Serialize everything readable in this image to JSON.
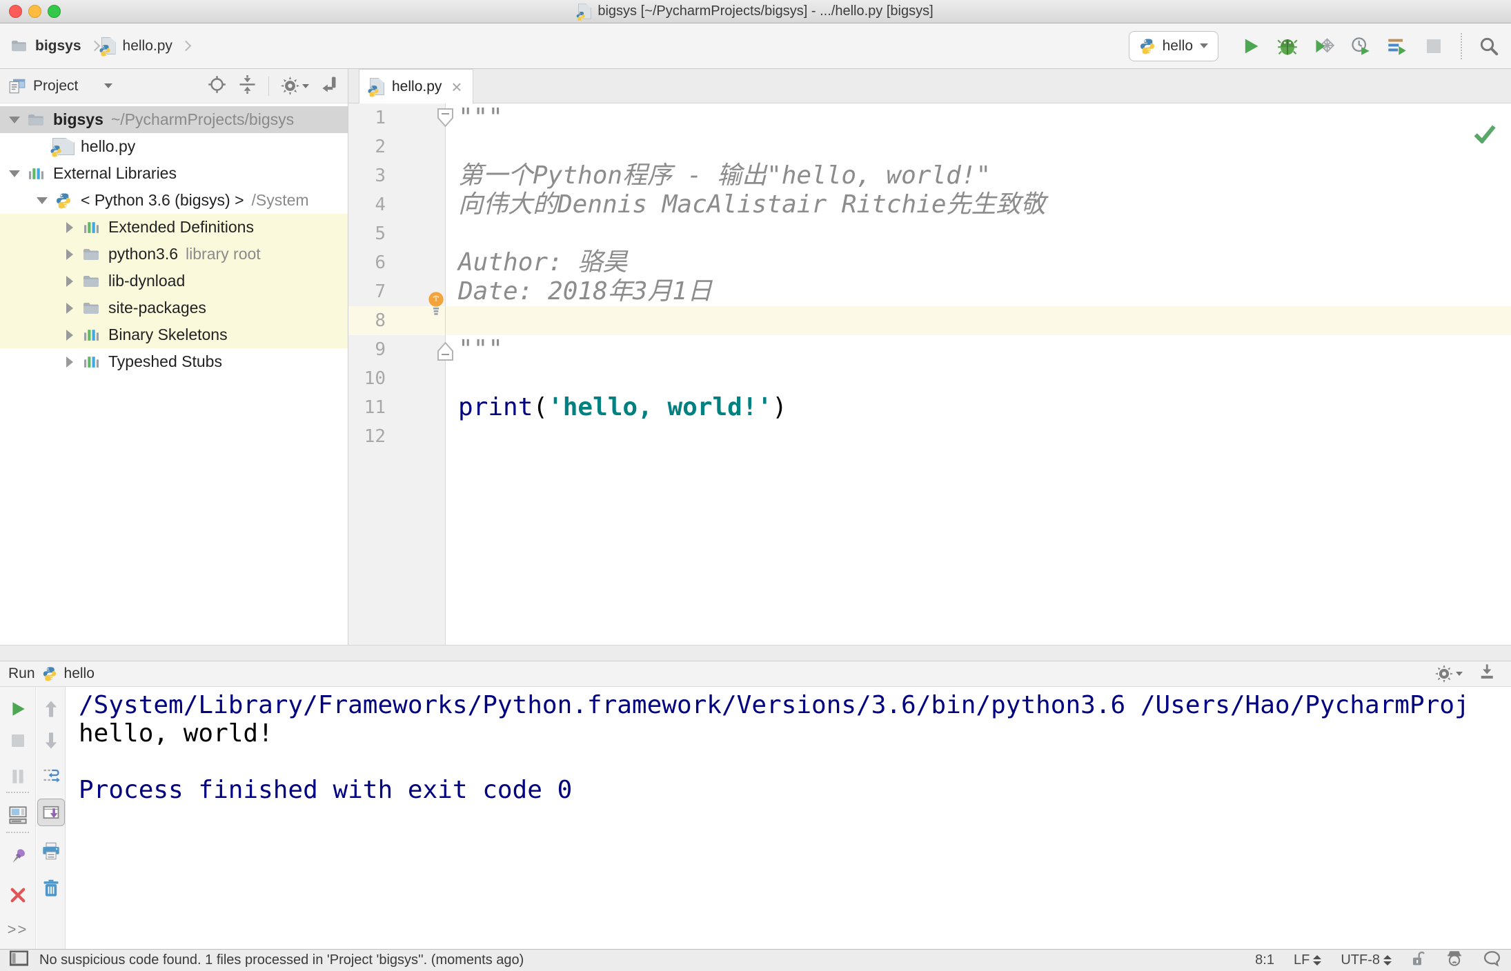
{
  "colors": {
    "run_green": "#4DA651",
    "keyword_blue": "#000080",
    "string_teal": "#008080",
    "console_blue": "#000080",
    "doc_comment_gray": "#8C8C8C",
    "selection_gray": "#D5D5D5",
    "scope_highlight_yellow": "#FBF9DC",
    "current_line_yellow": "#FCF9E7",
    "error_red": "#E05555",
    "pin_purple": "#A87BC9"
  },
  "title_bar": {
    "title": "bigsys [~/PycharmProjects/bigsys] - .../hello.py [bigsys]"
  },
  "nav_bar": {
    "breadcrumbs": [
      "bigsys",
      "hello.py"
    ],
    "run_config": "hello"
  },
  "project_panel": {
    "title": "Project",
    "tree": [
      {
        "label": "bigsys",
        "hint": "~/PycharmProjects/bigsys"
      },
      {
        "label": "hello.py"
      },
      {
        "label": "External Libraries"
      },
      {
        "label": "< Python 3.6 (bigsys) >",
        "hint": "/System"
      },
      {
        "label": "Extended Definitions"
      },
      {
        "label": "python3.6",
        "hint": "library root"
      },
      {
        "label": "lib-dynload"
      },
      {
        "label": "site-packages"
      },
      {
        "label": "Binary Skeletons"
      },
      {
        "label": "Typeshed Stubs"
      }
    ]
  },
  "editor": {
    "tab": "hello.py",
    "lines": [
      {
        "n": 1,
        "segments": [
          {
            "t": "\"\"\""
          }
        ]
      },
      {
        "n": 2,
        "segments": []
      },
      {
        "n": 3,
        "segments": [
          {
            "t": "第一个Python程序 - 输出\"hello, world!\""
          }
        ]
      },
      {
        "n": 4,
        "segments": [
          {
            "t": "向伟大的Dennis MacAlistair Ritchie先生致敬"
          }
        ]
      },
      {
        "n": 5,
        "segments": []
      },
      {
        "n": 6,
        "segments": [
          {
            "t": "Author: 骆昊"
          }
        ]
      },
      {
        "n": 7,
        "segments": [
          {
            "t": "Date: 2018年3月1日"
          }
        ]
      },
      {
        "n": 8,
        "segments": []
      },
      {
        "n": 9,
        "segments": [
          {
            "t": "\"\"\""
          }
        ]
      },
      {
        "n": 10,
        "segments": []
      },
      {
        "n": 11,
        "segments": [
          {
            "t": "print"
          },
          {
            "t": "("
          },
          {
            "t": "'hello, world!'"
          },
          {
            "t": ")"
          }
        ]
      },
      {
        "n": 12,
        "segments": []
      }
    ]
  },
  "run_panel": {
    "title": "Run",
    "config": "hello",
    "more_label": ">>",
    "console": [
      "/System/Library/Frameworks/Python.framework/Versions/3.6/bin/python3.6 /Users/Hao/PycharmProj",
      "hello, world!",
      "",
      "Process finished with exit code 0"
    ]
  },
  "status_bar": {
    "message": "No suspicious code found. 1 files processed in 'Project 'bigsys''. (moments ago)",
    "caret_position": "8:1",
    "line_separator": "LF",
    "encoding": "UTF-8"
  }
}
